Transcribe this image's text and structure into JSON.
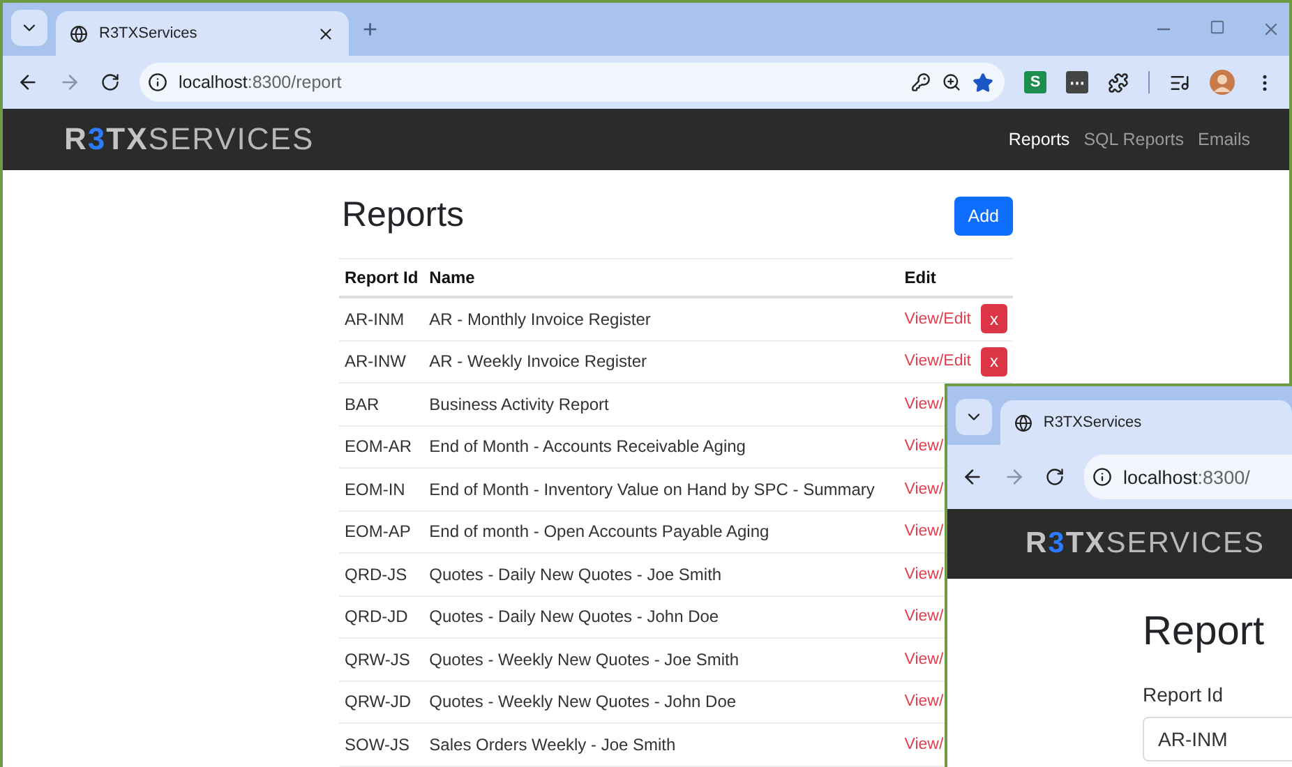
{
  "browser": {
    "tab": {
      "title": "R3TXServices",
      "selected": true
    },
    "new_tab": "+",
    "extensions": [
      {
        "label": "S",
        "color": "#1e8e4e"
      },
      {
        "label": "⋯",
        "color": "#444444"
      }
    ],
    "address": {
      "host": "localhost",
      "rest": ":8300/report"
    }
  },
  "navbar": {
    "logo": {
      "first": "R",
      "accent": "3",
      "bold": "TX",
      "rest": "SERVICES"
    },
    "links": [
      {
        "label": "Reports",
        "selected": true
      },
      {
        "label": "SQL Reports",
        "selected": false
      },
      {
        "label": "Emails",
        "selected": false
      }
    ]
  },
  "page": {
    "title": "Reports",
    "add_button": "Add",
    "table": {
      "columns": [
        "Report Id",
        "Name",
        "Edit"
      ],
      "rows": [
        {
          "id": "AR-INM",
          "name": "AR - Monthly Invoice Register",
          "link": "View/Edit",
          "delete": "x"
        },
        {
          "id": "AR-INW",
          "name": "AR - Weekly Invoice Register",
          "link": "View/Edit",
          "delete": "x"
        },
        {
          "id": "BAR",
          "name": "Business Activity Report",
          "link": "View/"
        },
        {
          "id": "EOM-AR",
          "name": "End of Month - Accounts Receivable Aging",
          "link": "View/"
        },
        {
          "id": "EOM-IN",
          "name": "End of Month - Inventory Value on Hand by SPC - Summary",
          "link": "View/"
        },
        {
          "id": "EOM-AP",
          "name": "End of month - Open Accounts Payable Aging",
          "link": "View/"
        },
        {
          "id": "QRD-JS",
          "name": "Quotes - Daily New Quotes - Joe Smith",
          "link": "View/"
        },
        {
          "id": "QRD-JD",
          "name": "Quotes - Daily New Quotes - John Doe",
          "link": "View/"
        },
        {
          "id": "QRW-JS",
          "name": "Quotes - Weekly New Quotes - Joe Smith",
          "link": "View/"
        },
        {
          "id": "QRW-JD",
          "name": "Quotes - Weekly New Quotes - John Doe",
          "link": "View/"
        },
        {
          "id": "SOW-JS",
          "name": "Sales Orders Weekly - Joe Smith",
          "link": "View/"
        }
      ]
    }
  },
  "second_window": {
    "tab": {
      "title": "R3TXServices"
    },
    "address": {
      "host": "localhost",
      "rest": ":8300/"
    },
    "logo": {
      "first": "R",
      "accent": "3",
      "bold": "TX",
      "rest": "SERVICES"
    },
    "title": "Report",
    "field": {
      "label": "Report Id",
      "value": "AR-INM"
    }
  }
}
